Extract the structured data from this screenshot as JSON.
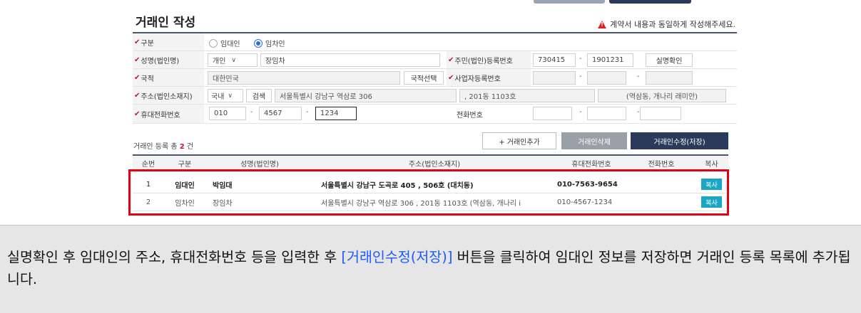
{
  "page": {
    "title": "거래인 작성",
    "warning": "계약서 내용과 동일하게 작성해주세요."
  },
  "form": {
    "type": {
      "label": "구분",
      "options": [
        "임대인",
        "임차인"
      ],
      "selected": "임차인"
    },
    "name": {
      "label": "성명(법인명)",
      "kind": "개인",
      "value": "장임차"
    },
    "id_no": {
      "label": "주민(법인)등록번호",
      "part1": "730415",
      "part2": "1901231",
      "verify_btn": "실명확인"
    },
    "nationality": {
      "label": "국적",
      "value": "대한민국",
      "select_btn": "국적선택"
    },
    "biz_no": {
      "label": "사업자등록번호",
      "part1": "",
      "part2": "",
      "part3": ""
    },
    "address": {
      "label": "주소(법인소재지)",
      "region": "국내",
      "search_btn": "검색",
      "road": "서울특별시 강남구 역삼로 306",
      "detail": ", 201동 1103호",
      "extra": "(역삼동, 개나리 래미안)"
    },
    "mobile": {
      "label": "휴대전화번호",
      "p1": "010",
      "p2": "4567",
      "p3": "1234"
    },
    "phone": {
      "label": "전화번호",
      "p1": "",
      "p2": "",
      "p3": ""
    }
  },
  "list": {
    "count_prefix": "거래인 등록 총",
    "count": "2",
    "count_suffix": "건",
    "add_btn": "+ 거래인추가",
    "delete_btn": "거래인삭제",
    "save_btn": "거래인수정(저장)",
    "columns": [
      "순번",
      "구분",
      "성명(법인명)",
      "주소(법인소재지)",
      "휴대전화번호",
      "전화번호",
      "복사"
    ],
    "rows": [
      {
        "no": "1",
        "type": "임대인",
        "name": "박임대",
        "address": "서울특별시 강남구 도곡로 405 , 506호  (대치동)",
        "mobile": "010-7563-9654",
        "phone": "",
        "copy": "복사"
      },
      {
        "no": "2",
        "type": "임차인",
        "name": "장임차",
        "address": "서울특별시 강남구 역삼로 306 , 201동 1103호  (역삼동, 개나리 i",
        "mobile": "010-4567-1234",
        "phone": "",
        "copy": "복사"
      }
    ]
  },
  "caption": {
    "before": "실명확인 후 임대인의 주소, 휴대전화번호 등을 입력한 후 ",
    "highlight": "[거래인수정(저장)]",
    "after": " 버튼을 클릭하여 임대인 정보를 저장하면 거래인 등록 목록에 추가됩니다."
  },
  "colors": {
    "accent": "#2b3a5a",
    "required": "#c8102e",
    "highlight_border": "#e60012",
    "copy_button": "#1aa7c4",
    "caption_link": "#1a5cff"
  }
}
